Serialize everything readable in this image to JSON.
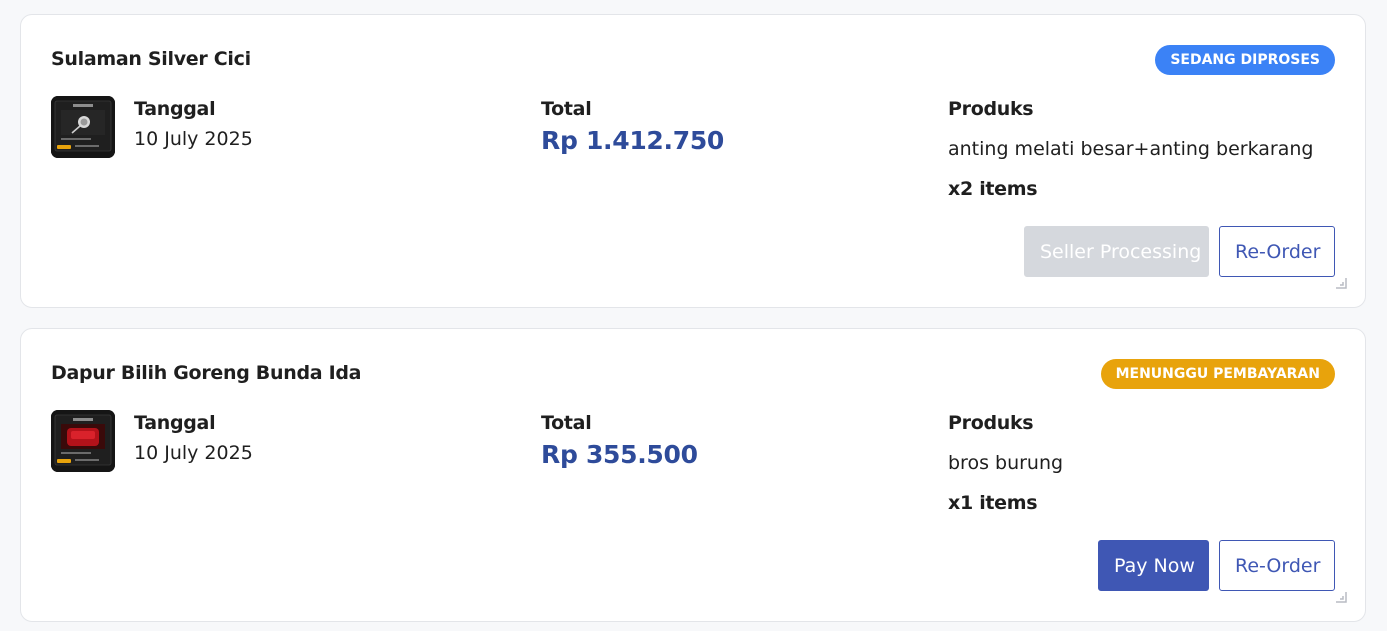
{
  "colors": {
    "accent": "#3f57b4",
    "price": "#2e4b9a",
    "status_processing": "#3b82f6",
    "status_waiting": "#e8a30c",
    "disabled": "#d5d8dd"
  },
  "orders": [
    {
      "seller": "Sulaman Silver Cici",
      "status": "SEDANG DIPROSES",
      "status_color": "#3b82f6",
      "thumbnail_icon": "product-thumbnail",
      "date_label": "Tanggal",
      "date": "10 July 2025",
      "total_label": "Total",
      "total": "Rp 1.412.750",
      "products_label": "Produks",
      "products": "anting melati besar+anting berkarang",
      "quantity": "x2 items",
      "primary_action": "Seller Processing",
      "primary_action_enabled": false,
      "secondary_action": "Re-Order"
    },
    {
      "seller": "Dapur Bilih Goreng Bunda Ida",
      "status": "MENUNGGU PEMBAYARAN",
      "status_color": "#e8a30c",
      "thumbnail_icon": "product-thumbnail",
      "date_label": "Tanggal",
      "date": "10 July 2025",
      "total_label": "Total",
      "total": "Rp 355.500",
      "products_label": "Produks",
      "products": "bros burung",
      "quantity": "x1 items",
      "primary_action": "Pay Now",
      "primary_action_enabled": true,
      "secondary_action": "Re-Order"
    }
  ]
}
